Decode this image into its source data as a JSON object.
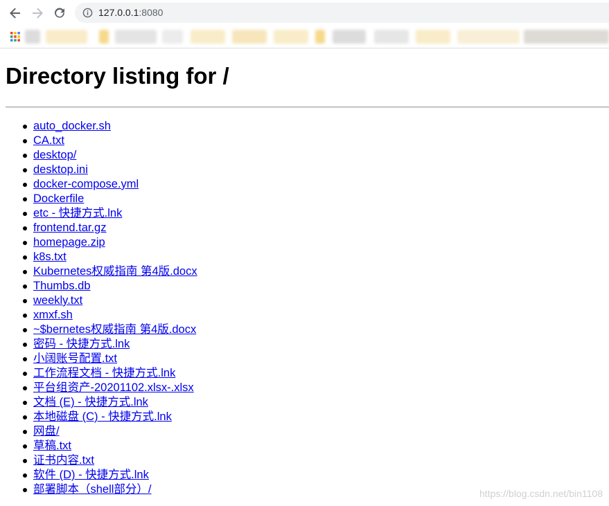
{
  "browser": {
    "url_host": "127.0.0.1",
    "url_port": ":8080"
  },
  "page": {
    "heading": "Directory listing for /",
    "files": [
      "auto_docker.sh",
      "CA.txt",
      "desktop/",
      "desktop.ini",
      "docker-compose.yml",
      "Dockerfile",
      "etc - 快捷方式.lnk",
      "frontend.tar.gz",
      "homepage.zip",
      "k8s.txt",
      "Kubernetes权威指南 第4版.docx",
      "Thumbs.db",
      "weekly.txt",
      "xmxf.sh",
      "~$bernetes权威指南 第4版.docx",
      "密码 - 快捷方式.lnk",
      "小阔账号配置.txt",
      "工作流程文档 - 快捷方式.lnk",
      "平台组资产-20201102.xlsx-.xlsx",
      "文档 (E) - 快捷方式.lnk",
      "本地磁盘 (C) - 快捷方式.lnk",
      "网盘/",
      "草稿.txt",
      "证书内容.txt",
      "软件 (D) - 快捷方式.lnk",
      "部署脚本（shell部分）/"
    ]
  },
  "watermark": "https://blog.csdn.net/bin1108",
  "colors": {
    "link": "#0000ee",
    "omnibox_bg": "#f1f3f4",
    "icon": "#5f6368"
  },
  "icons": {
    "back": "arrow-left-icon",
    "forward": "arrow-right-icon",
    "reload": "reload-icon",
    "site_info": "info-circle-icon",
    "apps": "apps-grid-icon"
  }
}
